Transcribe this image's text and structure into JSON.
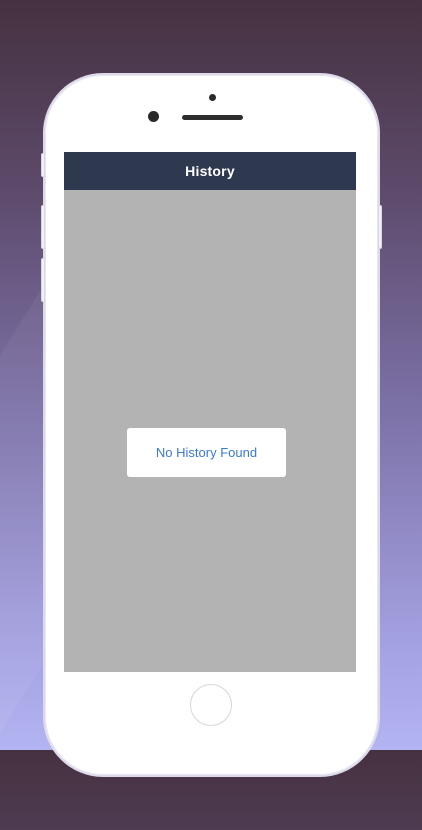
{
  "app": {
    "nav_title": "History"
  },
  "empty_state": {
    "message": "No History Found"
  },
  "colors": {
    "nav_bar": "#2e3950",
    "screen_bg": "#b3b3b3",
    "message_text": "#3b78d6",
    "device_body": "#ffffff"
  },
  "icons": {
    "home_button": "home-button-icon",
    "camera": "front-camera-icon"
  }
}
